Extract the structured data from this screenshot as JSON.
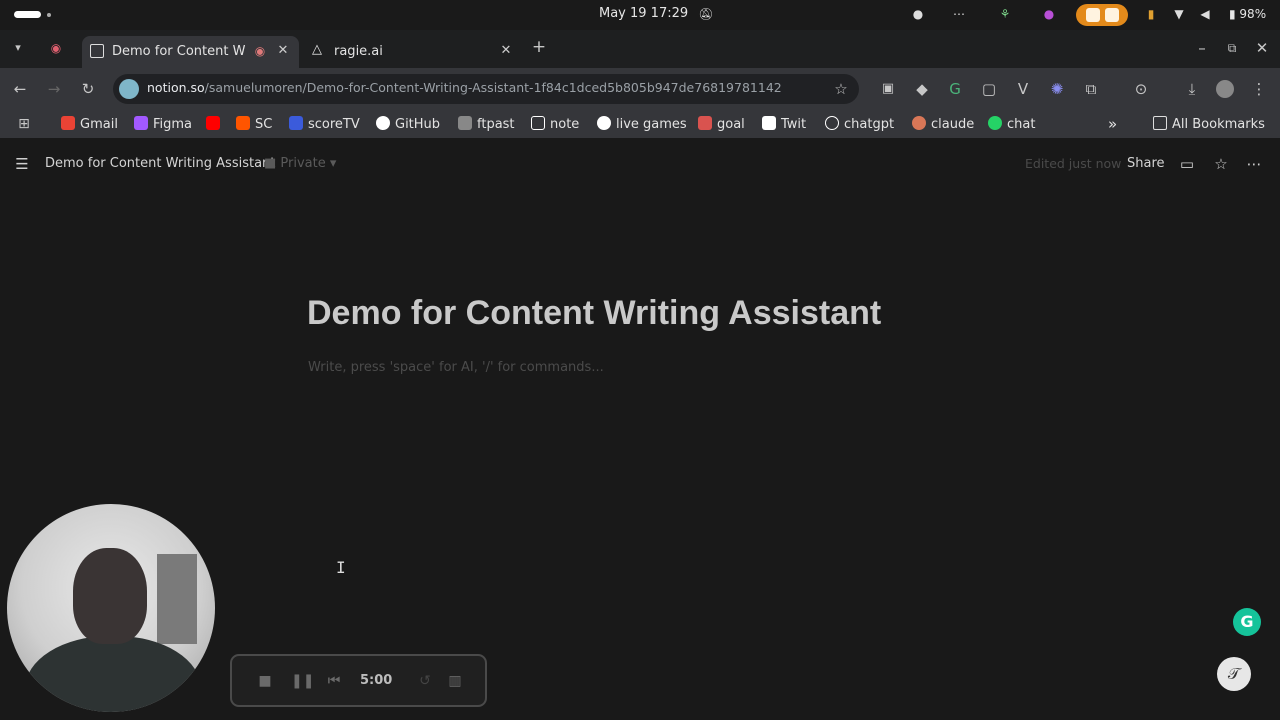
{
  "system": {
    "datetime": "May 19  17:29",
    "battery": "98%"
  },
  "tabs": [
    {
      "label": "Demo for Content W",
      "active": true
    },
    {
      "label": "ragie.ai",
      "active": false
    }
  ],
  "omnibox": {
    "domain": "notion.so",
    "path": "/samuelumoren/Demo-for-Content-Writing-Assistant-1f84c1dced5b805b947de76819781142"
  },
  "bookmarks": [
    {
      "label": "Gmail",
      "icon": "gmail-icon",
      "color": "#ea4335"
    },
    {
      "label": "Figma",
      "icon": "figma-icon",
      "color": "#a259ff"
    },
    {
      "label": "",
      "icon": "youtube-icon",
      "color": "#ff0000"
    },
    {
      "label": "SC",
      "icon": "soundcloud-icon",
      "color": "#ff5500"
    },
    {
      "label": "scoreTV",
      "icon": "scoretv-icon",
      "color": "#3b5bdb"
    },
    {
      "label": "GitHub",
      "icon": "github-icon",
      "color": "#ffffff"
    },
    {
      "label": "ftpast",
      "icon": "ftpast-icon",
      "color": "#cccccc"
    },
    {
      "label": "note",
      "icon": "notion-icon",
      "color": "#ffffff"
    },
    {
      "label": "live games",
      "icon": "globe-icon",
      "color": "#ffffff"
    },
    {
      "label": "goal",
      "icon": "goal-icon",
      "color": "#d9534f"
    },
    {
      "label": "Twit",
      "icon": "x-icon",
      "color": "#ffffff"
    },
    {
      "label": "chatgpt",
      "icon": "openai-icon",
      "color": "#ffffff"
    },
    {
      "label": "claude",
      "icon": "claude-icon",
      "color": "#d97757"
    },
    {
      "label": "chat",
      "icon": "whatsapp-icon",
      "color": "#25d366"
    }
  ],
  "all_bookmarks": "All Bookmarks",
  "notion_header": {
    "title": "Demo for Content Writing Assistant",
    "privacy": "Private",
    "edited": "Edited just now",
    "share": "Share"
  },
  "page": {
    "title": "Demo for Content Writing Assistant",
    "placeholder": "Write, press 'space' for AI, '/' for commands..."
  },
  "recorder": {
    "time": "5:00"
  },
  "colors": {
    "background": "#191919",
    "accent_orange": "#e38a1b",
    "grammarly": "#15c39a"
  }
}
